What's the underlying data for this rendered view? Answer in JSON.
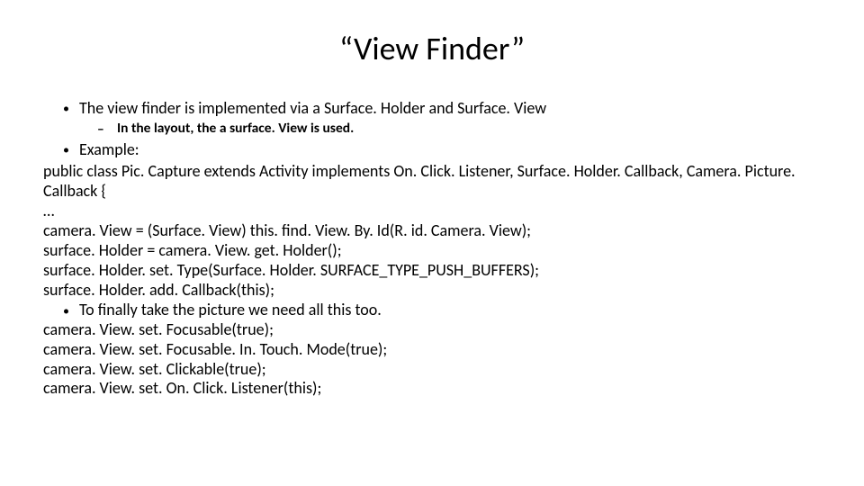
{
  "title": "“View Finder”",
  "bullet1": "The view finder is implemented via a Surface. Holder and Surface. View",
  "sub1": "In the layout, the a surface. View is used.",
  "bullet2": "Example:",
  "code": {
    "l1": "public class Pic. Capture extends Activity implements On. Click. Listener, Surface. Holder. Callback, Camera. Picture. Callback {",
    "l2": "…",
    "l3": "camera. View = (Surface. View) this. find. View. By. Id(R. id. Camera. View);",
    "l4": "surface. Holder = camera. View. get. Holder();",
    "l5": "surface. Holder. set. Type(Surface. Holder. SURFACE_TYPE_PUSH_BUFFERS);",
    "l6": "surface. Holder. add. Callback(this);"
  },
  "bullet3": "To finally take the picture we need all this too.",
  "code2": {
    "l1": "camera. View. set. Focusable(true);",
    "l2": "camera. View. set. Focusable. In. Touch. Mode(true);",
    "l3": "camera. View. set. Clickable(true);",
    "l4": "camera. View. set. On. Click. Listener(this);"
  }
}
